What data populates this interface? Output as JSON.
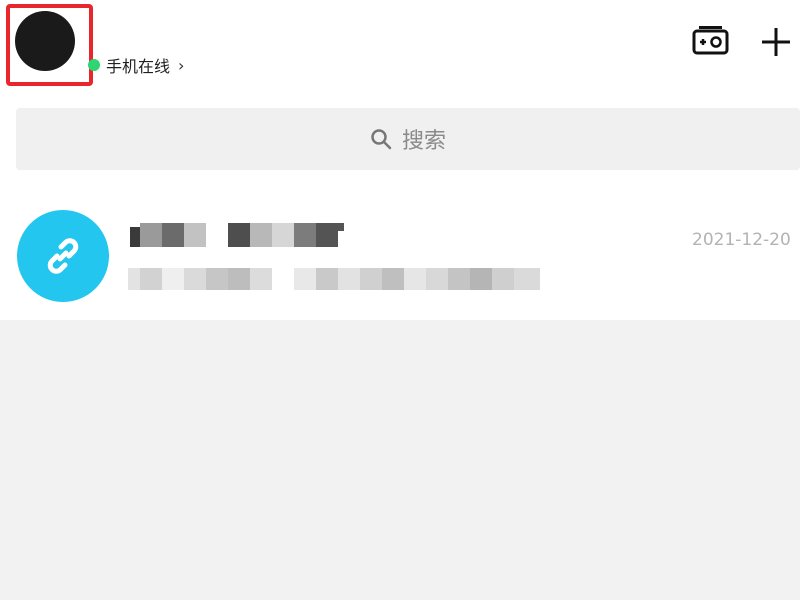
{
  "header": {
    "status_text": "手机在线",
    "status_chevron": "›",
    "status_color": "#2ed573",
    "icons": [
      "camera-icon",
      "plus-icon"
    ]
  },
  "search": {
    "placeholder": "搜索",
    "icon": "search-icon"
  },
  "conversations": [
    {
      "avatar_icon": "link-icon",
      "avatar_color": "#22c6ee",
      "time": "2021-12-20"
    }
  ],
  "highlight": {
    "color": "#e8262b"
  }
}
